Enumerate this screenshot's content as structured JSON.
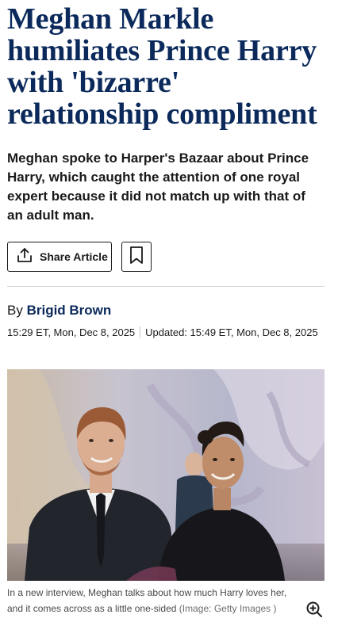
{
  "article": {
    "headline": "Meghan Markle humiliates Prince Harry with 'bizarre' relationship compliment",
    "standfirst": "Meghan spoke to Harper's Bazaar about Prince Harry, which caught the attention of one royal expert because it did not match up with that of an adult man.",
    "share_label": "Share Article",
    "byline_prefix": "By",
    "author": "Brigid Brown",
    "published": "15:29 ET, Mon, Dec 8, 2025",
    "updated": "Updated: 15:49 ET, Mon, Dec 8, 2025",
    "image": {
      "caption": "In a new interview, Meghan talks about how much Harry loves her, and it comes across as a little one-sided",
      "credit": "(Image: Getty Images )"
    }
  },
  "colors": {
    "headline": "#0b2a5b",
    "author": "#0b2a5b",
    "text": "#1a1a1a",
    "caption": "#4a4a4a",
    "divider": "#d6d6d6"
  },
  "icons": {
    "share": "share-icon",
    "bookmark": "bookmark-icon",
    "zoom": "zoom-in-icon"
  }
}
